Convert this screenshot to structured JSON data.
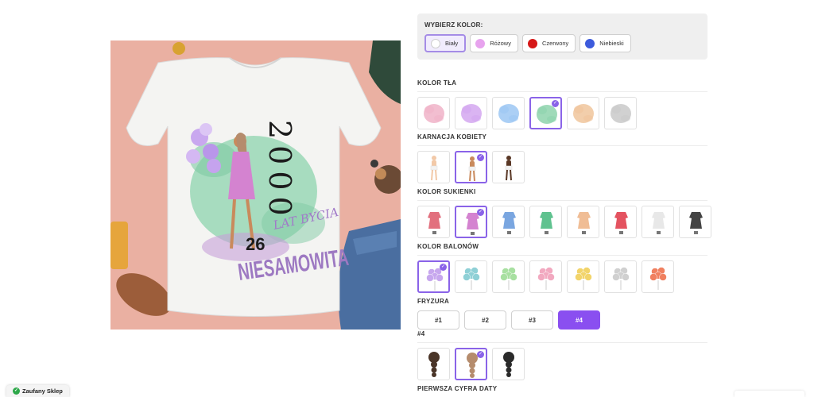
{
  "product": {
    "print_year": "2000",
    "print_age": "26",
    "print_line": "LAT BYCIA",
    "print_title": "NIESAMOWITA"
  },
  "color_panel": {
    "title": "WYBIERZ KOLOR:",
    "options": [
      {
        "label": "Biały",
        "color": "#ffffff",
        "selected": true
      },
      {
        "label": "Różowy",
        "color": "#e7a3ee",
        "selected": false
      },
      {
        "label": "Czerwony",
        "color": "#d61818",
        "selected": false
      },
      {
        "label": "Niebieski",
        "color": "#3d5bdc",
        "selected": false
      }
    ]
  },
  "sections": {
    "background": {
      "label": "KOLOR TŁA",
      "swatches": [
        "#f0b3c8",
        "#d4a7f0",
        "#9cc7f3",
        "#8ed4ad",
        "#f0c59c",
        "#c9c9c9"
      ],
      "selected": 3
    },
    "skin": {
      "label": "KARNACJA KOBIETY",
      "tones": [
        "#f2c9a8",
        "#c98a5c",
        "#5a3826"
      ],
      "selected": 1
    },
    "dress": {
      "label": "KOLOR SUKIENKI",
      "colors": [
        "#e2707e",
        "#d483d0",
        "#7aa6e0",
        "#5fc28f",
        "#f0bd95",
        "#e45360",
        "#e8e8e8",
        "#444444"
      ],
      "selected": 1
    },
    "balloons": {
      "label": "KOLOR BALONÓW",
      "colors": [
        "#c7a7ee",
        "#8fd0d6",
        "#a8e0a1",
        "#f2a9c0",
        "#f2d46a",
        "#d0d0d0",
        "#f08060"
      ],
      "selected": 0
    },
    "hairstyle": {
      "label": "FRYZURA",
      "options": [
        "#1",
        "#2",
        "#3",
        "#4"
      ],
      "selected": 3
    },
    "hair_color": {
      "label": "#4",
      "colors": [
        "#4a3528",
        "#b58c6d",
        "#2a2a2a"
      ],
      "selected": 1
    },
    "first_digit": {
      "label": "PIERWSZA CYFRA DATY"
    }
  },
  "badge": {
    "label": "Zaufany Sklep"
  }
}
